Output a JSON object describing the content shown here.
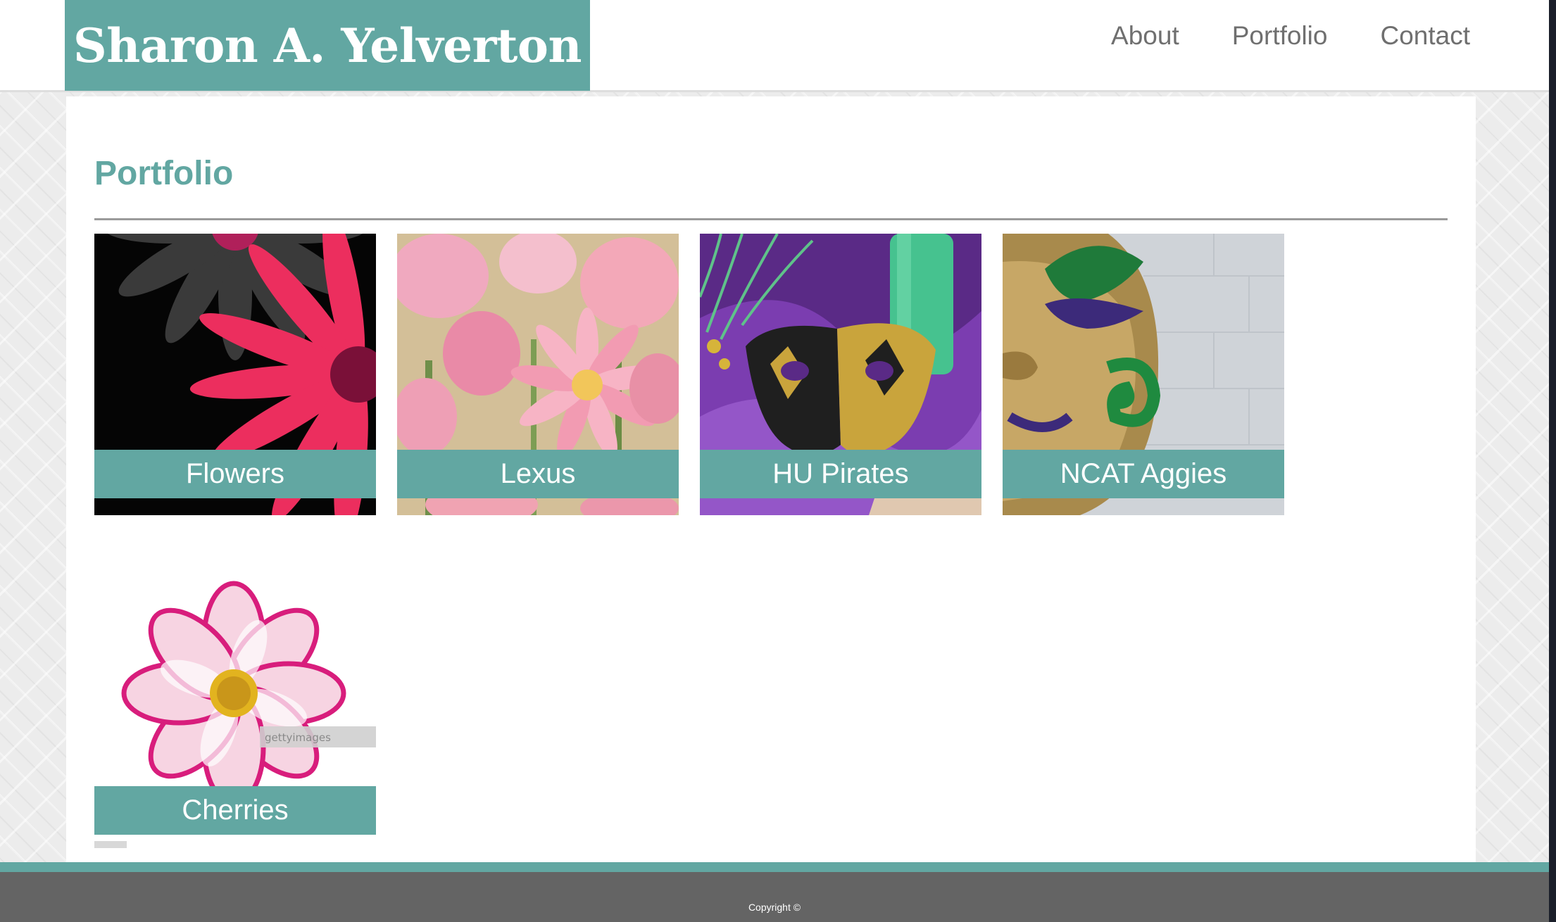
{
  "header": {
    "site_title": "Sharon A. Yelverton",
    "nav": [
      {
        "label": "About"
      },
      {
        "label": "Portfolio"
      },
      {
        "label": "Contact"
      }
    ]
  },
  "main": {
    "page_title": "Portfolio",
    "gallery": [
      {
        "label": "Flowers",
        "image": "pink-daisy-on-grey-daisies"
      },
      {
        "label": "Lexus",
        "image": "pink-dahlias"
      },
      {
        "label": "HU Pirates",
        "image": "black-gold-mask-on-purple-satin"
      },
      {
        "label": "NCAT Aggies",
        "image": "gold-green-mardi-gras-mask"
      },
      {
        "label": "Cherries",
        "image": "pink-cosmos-flower",
        "watermark": "gettyimages"
      }
    ]
  },
  "footer": {
    "copyright": "Copyright ©"
  },
  "colors": {
    "brand": "#62a7a2",
    "nav_text": "#6f6f6f",
    "footer_bg": "#646464"
  }
}
